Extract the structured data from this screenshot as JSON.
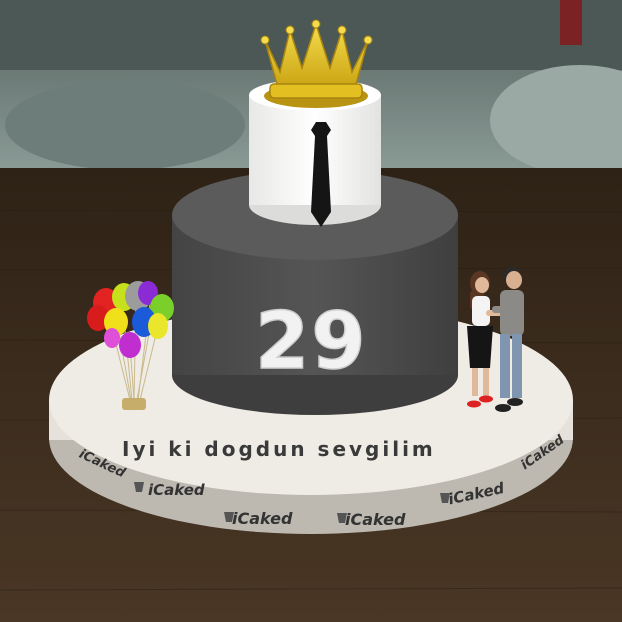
{
  "scene": {
    "age_number": "29",
    "message": "Iyi ki dogdun sevgilim",
    "brand_label": "iCaked",
    "colors": {
      "floor": "#3b2c1c",
      "wall": "#7e8f8a",
      "cake_bottom_tier": "#4e4e4e",
      "cake_top_tier": "#f4f4f2",
      "board": "#efece6",
      "crown": "#e7c21d",
      "tie": "#151515",
      "number": "#f2f2f2",
      "message_text": "#3a3a3a"
    },
    "icons": {
      "crown": "crown-icon",
      "tie": "necktie-icon",
      "balloons": "balloon-bunch-icon",
      "couple": "couple-figures-icon",
      "cupcake": "cupcake-logo-icon"
    }
  }
}
